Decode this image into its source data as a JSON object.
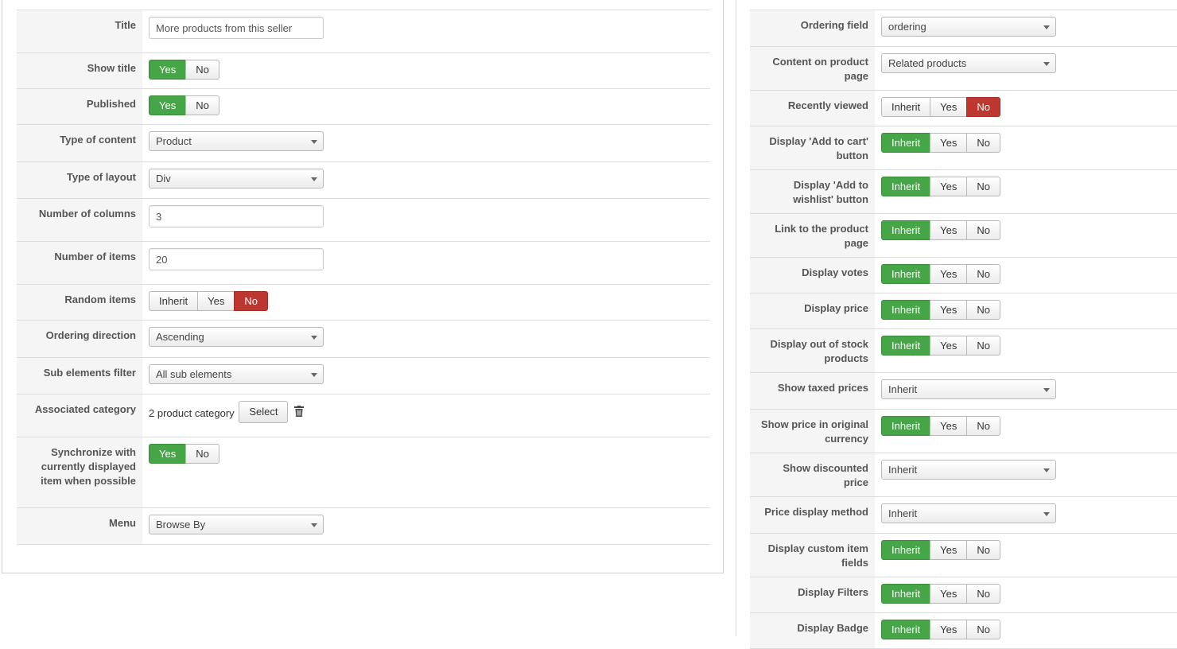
{
  "left": {
    "title": {
      "label": "Title",
      "value": "More products from this seller"
    },
    "show_title": {
      "label": "Show title",
      "options": [
        "Yes",
        "No"
      ]
    },
    "published": {
      "label": "Published",
      "options": [
        "Yes",
        "No"
      ]
    },
    "type_of_content": {
      "label": "Type of content",
      "value": "Product"
    },
    "type_of_layout": {
      "label": "Type of layout",
      "value": "Div"
    },
    "number_of_columns": {
      "label": "Number of columns",
      "value": "3"
    },
    "number_of_items": {
      "label": "Number of items",
      "value": "20"
    },
    "random_items": {
      "label": "Random items",
      "options": [
        "Inherit",
        "Yes",
        "No"
      ]
    },
    "ordering_direction": {
      "label": "Ordering direction",
      "value": "Ascending"
    },
    "sub_elements_filter": {
      "label": "Sub elements filter",
      "value": "All sub elements"
    },
    "associated_category": {
      "label": "Associated category",
      "text": "2 product category",
      "button": "Select"
    },
    "synchronize": {
      "label": "Synchronize with currently displayed item when possible",
      "options": [
        "Yes",
        "No"
      ]
    },
    "menu": {
      "label": "Menu",
      "value": "Browse By"
    }
  },
  "right": {
    "ordering_field": {
      "label": "Ordering field",
      "value": "ordering"
    },
    "content_on_product_page": {
      "label": "Content on product page",
      "value": "Related products"
    },
    "recently_viewed": {
      "label": "Recently viewed",
      "options": [
        "Inherit",
        "Yes",
        "No"
      ]
    },
    "add_to_cart": {
      "label": "Display 'Add to cart' button",
      "options": [
        "Inherit",
        "Yes",
        "No"
      ]
    },
    "add_to_wishlist": {
      "label": "Display 'Add to wishlist' button",
      "options": [
        "Inherit",
        "Yes",
        "No"
      ]
    },
    "link_product_page": {
      "label": "Link to the product page",
      "options": [
        "Inherit",
        "Yes",
        "No"
      ]
    },
    "display_votes": {
      "label": "Display votes",
      "options": [
        "Inherit",
        "Yes",
        "No"
      ]
    },
    "display_price": {
      "label": "Display price",
      "options": [
        "Inherit",
        "Yes",
        "No"
      ]
    },
    "out_of_stock": {
      "label": "Display out of stock products",
      "options": [
        "Inherit",
        "Yes",
        "No"
      ]
    },
    "show_taxed_prices": {
      "label": "Show taxed prices",
      "value": "Inherit"
    },
    "original_currency": {
      "label": "Show price in original currency",
      "options": [
        "Inherit",
        "Yes",
        "No"
      ]
    },
    "discounted_price": {
      "label": "Show discounted price",
      "value": "Inherit"
    },
    "price_display_method": {
      "label": "Price display method",
      "value": "Inherit"
    },
    "custom_item_fields": {
      "label": "Display custom item fields",
      "options": [
        "Inherit",
        "Yes",
        "No"
      ]
    },
    "display_filters": {
      "label": "Display Filters",
      "options": [
        "Inherit",
        "Yes",
        "No"
      ]
    },
    "display_badge": {
      "label": "Display Badge",
      "options": [
        "Inherit",
        "Yes",
        "No"
      ]
    }
  },
  "colors": {
    "active_green": "#46a546",
    "active_red": "#bd362f",
    "label_bg": "#f5f5f5",
    "border": "#dcdcdc"
  }
}
